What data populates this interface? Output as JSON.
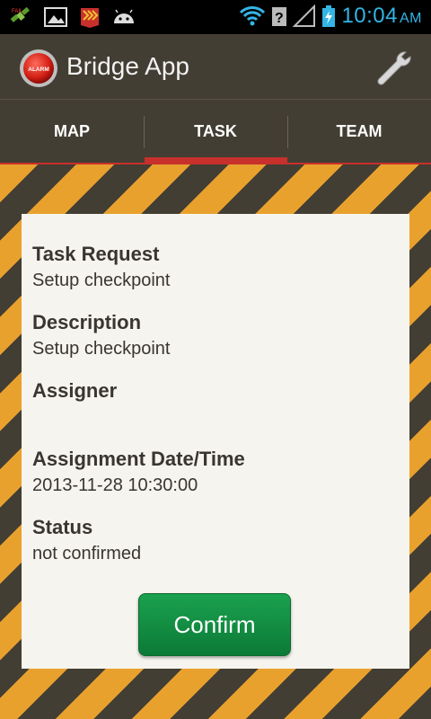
{
  "status_bar": {
    "time": "10:04",
    "ampm": "AM",
    "left_icons": [
      "satellite-icon",
      "image-icon",
      "flag-icon",
      "android-icon"
    ],
    "right_icons": [
      "wifi-icon",
      "unknown-signal-icon",
      "signal-icon",
      "battery-charging-icon"
    ],
    "accent_color": "#33b5e5"
  },
  "header": {
    "title": "Bridge App",
    "logo_icon": "alarm-icon",
    "settings_icon": "wrench-icon"
  },
  "tabs": [
    {
      "label": "MAP",
      "selected": false
    },
    {
      "label": "TASK",
      "selected": true
    },
    {
      "label": "TEAM",
      "selected": false
    }
  ],
  "colors": {
    "bar_bg": "#433e33",
    "accent_red": "#c8302c",
    "hazard_yellow": "#e9a12e",
    "card_bg": "#f6f4ee",
    "confirm_green": "#128f45"
  },
  "task": {
    "request_label": "Task Request",
    "request_value": "Setup checkpoint",
    "description_label": "Description",
    "description_value": "Setup checkpoint",
    "assigner_label": "Assigner",
    "assigner_value": "",
    "datetime_label": "Assignment Date/Time",
    "datetime_value": "2013-11-28 10:30:00",
    "status_label": "Status",
    "status_value": "not confirmed"
  },
  "actions": {
    "confirm_label": "Confirm"
  }
}
